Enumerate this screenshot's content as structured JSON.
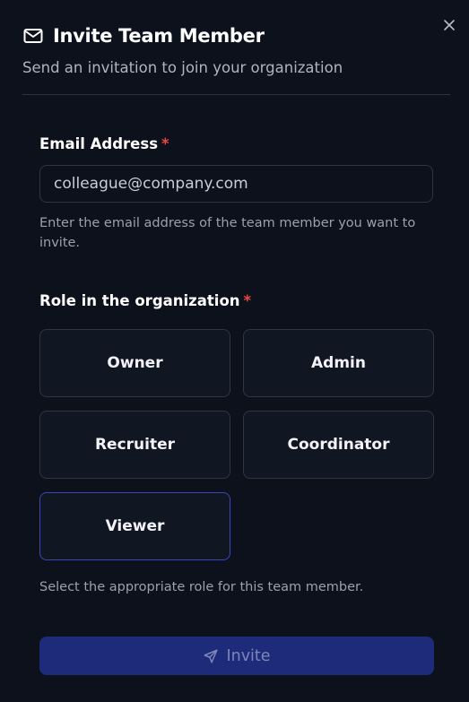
{
  "dialog": {
    "title": "Invite Team Member",
    "subtitle": "Send an invitation to join your organization",
    "close_icon": "close-icon",
    "title_icon": "mail-icon"
  },
  "email": {
    "label": "Email Address",
    "required_mark": "*",
    "value": "colleague@company.com",
    "help": "Enter the email address of the team member you want to invite."
  },
  "role": {
    "label": "Role in the organization",
    "required_mark": "*",
    "options": [
      "Owner",
      "Admin",
      "Recruiter",
      "Coordinator",
      "Viewer"
    ],
    "selected": "Viewer",
    "help": "Select the appropriate role for this team member."
  },
  "submit": {
    "label": "Invite",
    "icon": "send-icon",
    "enabled": false
  },
  "colors": {
    "background": "#0c111c",
    "required": "#ef4444",
    "selected_border": "#3a47b8",
    "button_bg": "#1d2b7a"
  }
}
